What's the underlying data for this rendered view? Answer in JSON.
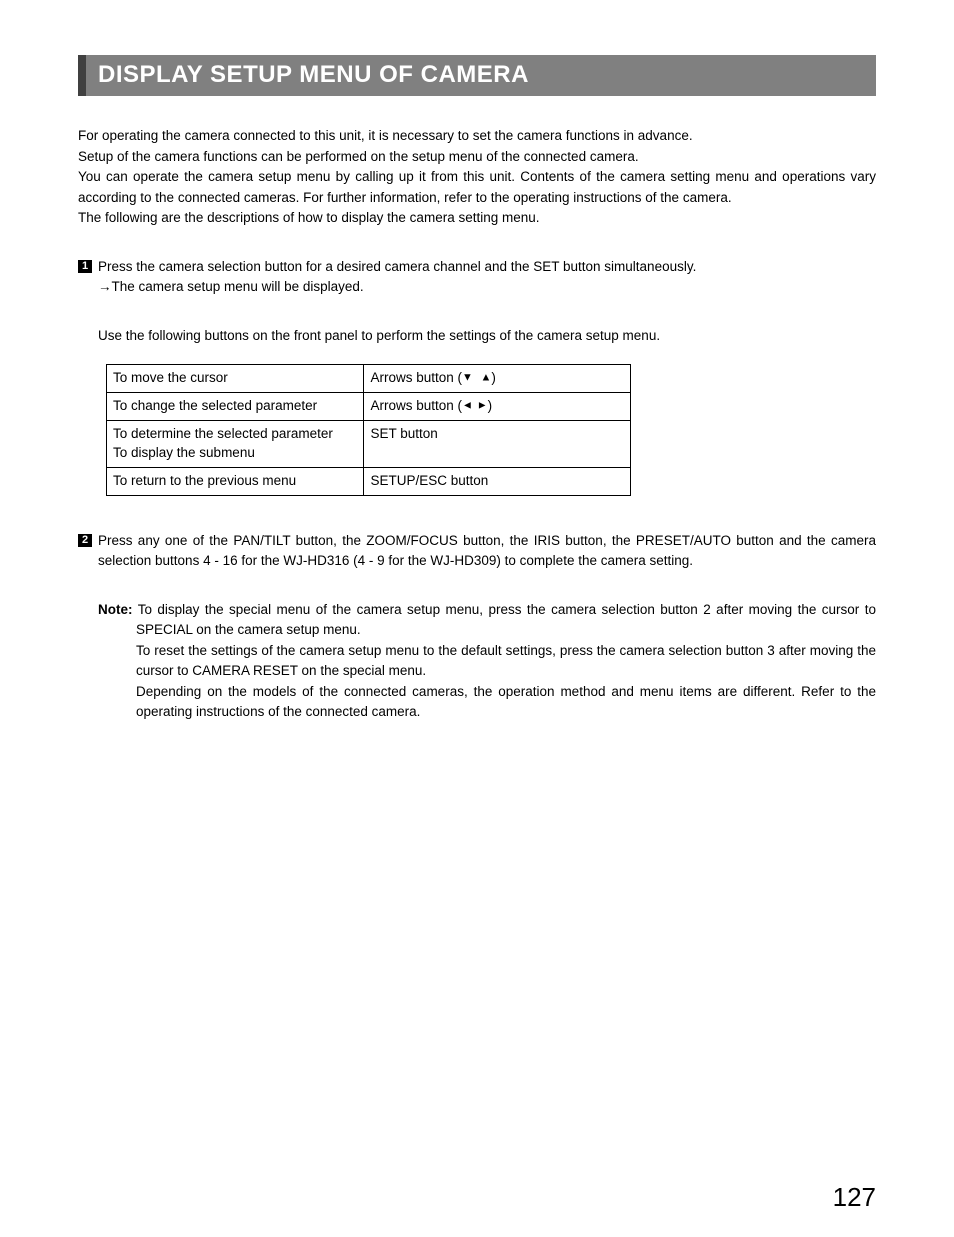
{
  "title": "DISPLAY SETUP MENU OF CAMERA",
  "intro": {
    "l1": "For operating the camera connected to this unit, it is necessary to set the camera functions in advance.",
    "l2": "Setup of the camera functions can be performed on the setup menu of the connected camera.",
    "l3": "You can operate the camera setup menu by calling up it from this unit. Contents of the camera setting menu and operations vary according to the connected cameras. For further information, refer to the operating instructions of the camera.",
    "l4": "The following are the descriptions of how to display the camera setting menu."
  },
  "step1": {
    "num": "1",
    "text": "Press the camera selection button for a desired camera channel and the SET button simultaneously.",
    "sub": "→The camera setup menu will be displayed."
  },
  "mid_note": "Use the following buttons on the front panel to perform the settings of the camera setup menu.",
  "table": {
    "r1": {
      "c1": "To move the cursor",
      "c2a": "Arrows button (",
      "c2b": ")"
    },
    "r2": {
      "c1": "To change the selected parameter",
      "c2a": "Arrows button (",
      "c2b": ")"
    },
    "r3": {
      "c1a": "To determine the selected parameter",
      "c1b": "To display the submenu",
      "c2": "SET button"
    },
    "r4": {
      "c1": "To return to the previous menu",
      "c2": "SETUP/ESC button"
    }
  },
  "step2": {
    "num": "2",
    "text": "Press any one of the PAN/TILT button, the ZOOM/FOCUS button, the IRIS button, the PRESET/AUTO button and the camera selection buttons 4 - 16 for the WJ-HD316 (4 - 9 for the WJ-HD309) to complete the camera setting."
  },
  "note": {
    "label": "Note:",
    "l1": " To display the special menu of the camera setup menu, press the camera selection button 2 after moving the cursor to SPECIAL on the camera setup menu.",
    "l2": "To reset the settings of the camera setup menu to the default settings, press the camera selection button 3 after moving the cursor to CAMERA RESET on the special menu.",
    "l3": "Depending on the models of the connected cameras, the operation method and menu items are different. Refer to the operating instructions of the connected camera."
  },
  "page_number": "127",
  "arrows": {
    "down": "▼",
    "up": "▲",
    "left": "◄",
    "right": "►"
  }
}
